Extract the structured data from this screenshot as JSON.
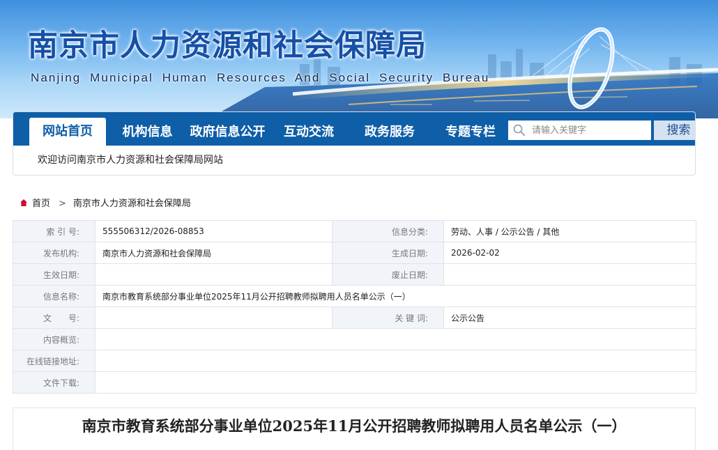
{
  "banner": {
    "title": "南京市人力资源和社会保障局",
    "subtitle": "Nanjing Municipal Human Resources And Social Security Bureau"
  },
  "nav": {
    "items": [
      {
        "label": "网站首页",
        "active": true
      },
      {
        "label": "机构信息"
      },
      {
        "label": "政府信息公开"
      },
      {
        "label": "互动交流"
      },
      {
        "label": "政务服务"
      },
      {
        "label": "专题专栏"
      }
    ],
    "search_placeholder": "请输入关键字",
    "search_button": "搜索",
    "welcome": "欢迎访问南京市人力资源和社会保障局网站"
  },
  "breadcrumb": {
    "home": "首页",
    "current": "南京市人力资源和社会保障局"
  },
  "info": {
    "index_label": "索 引 号:",
    "index_value": "555506312/2026-08853",
    "category_label": "信息分类:",
    "category_value": "劳动、人事 / 公示公告 / 其他",
    "publisher_label": "发布机构:",
    "publisher_value": "南京市人力资源和社会保障局",
    "date_label": "生成日期:",
    "date_value": "2026-02-02",
    "effective_label": "生效日期:",
    "effective_value": "",
    "expire_label": "废止日期:",
    "expire_value": "",
    "name_label": "信息名称:",
    "name_value": "南京市教育系统部分事业单位2025年11月公开招聘教师拟聘用人员名单公示（一）",
    "doc_label": "文　　号:",
    "doc_value": "",
    "keyword_label": "关 键 词:",
    "keyword_value": "公示公告",
    "summary_label": "内容概览:",
    "summary_value": "",
    "link_label": "在线链接地址:",
    "link_value": "",
    "download_label": "文件下载:",
    "download_value": ""
  },
  "article": {
    "title": "南京市教育系统部分事业单位2025年11月公开招聘教师拟聘用人员名单公示（一）"
  },
  "colors": {
    "nav_blue": "#0e5ea8",
    "title_blue": "#1550a8",
    "label_bg": "#f1f5fa"
  }
}
